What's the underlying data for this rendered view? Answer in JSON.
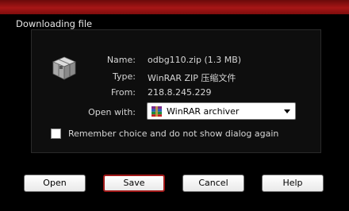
{
  "dialog": {
    "title": "Downloading file"
  },
  "file": {
    "icon": "archive-file-icon",
    "name_label": "Name:",
    "name_value": "odbg110.zip (1.3 MB)",
    "type_label": "Type:",
    "type_value": "WinRAR ZIP 压缩文件",
    "from_label": "From:",
    "from_value": "218.8.245.229",
    "open_with_label": "Open with:",
    "open_with_value": "WinRAR archiver",
    "open_with_icon": "winrar-icon"
  },
  "remember": {
    "label": "Remember choice and do not show dialog again",
    "checked": false
  },
  "buttons": {
    "open": "Open",
    "save": "Save",
    "cancel": "Cancel",
    "help": "Help"
  },
  "colors": {
    "titlebar": "#a81616",
    "background": "#000000",
    "default_button_border": "#a01818"
  }
}
